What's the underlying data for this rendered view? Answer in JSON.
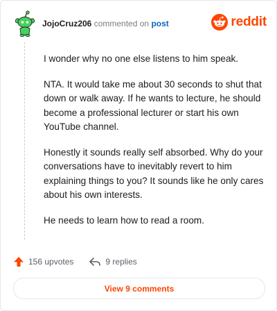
{
  "comment": {
    "author": "JojoCruz206",
    "action_text": "commented on",
    "post_link": "post",
    "paragraphs": [
      "I wonder why no one else listens to him speak.",
      "NTA. It would take me about 30 seconds to shut that down or walk away. If he wants to lecture, he should become a professional lecturer or start his own YouTube channel.",
      "Honestly it sounds really self absorbed. Why do your conversations have to inevitably revert to him explaining things to you? It sounds like he only cares about his own interests.",
      "He needs to learn how to read a room."
    ]
  },
  "brand": {
    "name": "reddit",
    "icon": "reddit-alien-icon",
    "color": "#ff4500"
  },
  "avatar": {
    "icon": "snoo-avatar-icon",
    "color": "#46d160"
  },
  "actions": {
    "upvotes": "156 upvotes",
    "replies": "9 replies"
  },
  "view_comments": "View 9 comments",
  "colors": {
    "accent": "#ff4500",
    "link": "#0a66c2",
    "text": "#1c1c1c"
  }
}
